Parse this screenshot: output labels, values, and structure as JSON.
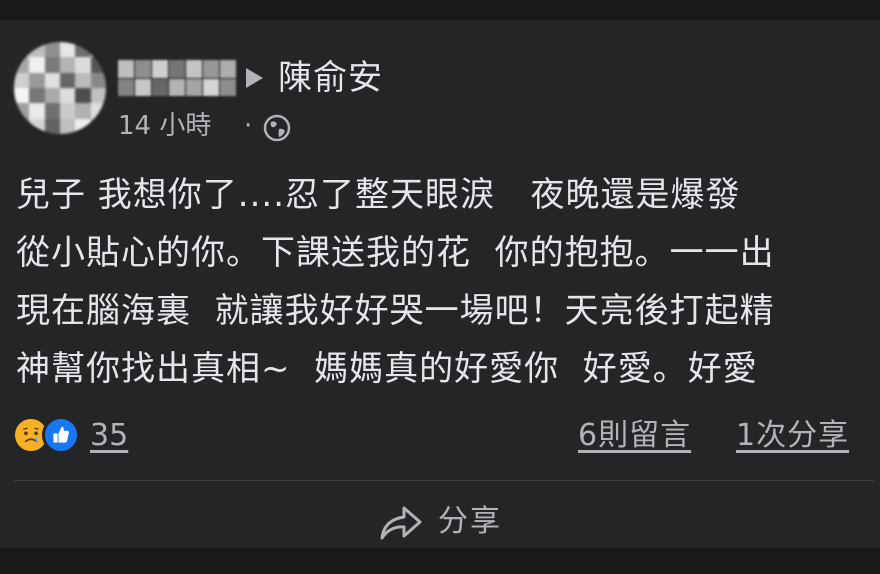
{
  "post": {
    "page_name": "陳俞安",
    "timestamp": "14 小時",
    "separator": "·",
    "audience_icon": "globe-icon",
    "lines": [
      "兒子 我想你了....忍了整天眼淚   夜晚還是爆發",
      "從小貼心的你。下課送我的花  你的抱抱。一一出",
      "現在腦海裏  就讓我好好哭一場吧！天亮後打起精",
      "神幫你找出真相~  媽媽真的好愛你  好愛。好愛"
    ]
  },
  "reactions": {
    "icons": [
      "sad-reaction-icon",
      "like-reaction-icon"
    ],
    "count": "35",
    "colors": {
      "sad": "#f7b125",
      "like": "#1877f2"
    }
  },
  "stats": {
    "comments": "6則留言",
    "shares": "1次分享"
  },
  "actions": {
    "share_label": "分享",
    "share_icon": "share-arrow-icon"
  },
  "theme": {
    "background": "#18191a",
    "card": "#242526",
    "text_primary": "#e4e6eb",
    "text_secondary": "#b0b3b8"
  }
}
